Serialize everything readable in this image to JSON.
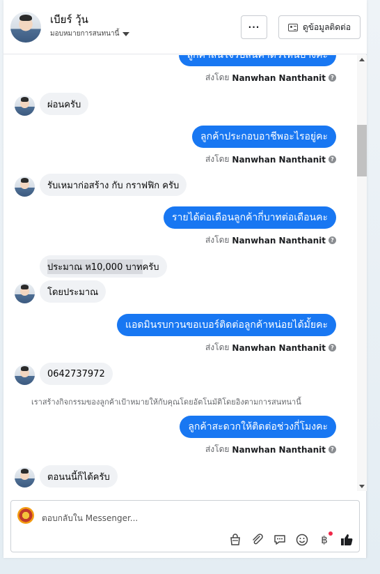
{
  "header": {
    "name": "เบียร์ วุ้น",
    "assignment": "มอบหมายการสนทนานี้",
    "more_label": "···",
    "contact_label": "ดูข้อมูลติดต่อ"
  },
  "thread": {
    "top_partial_text": "ลูกค้าสนใจรับสินค้าตัวไหนบ้างคะ",
    "sent_by_prefix": "ส่งโดย",
    "sender_name": "Nanwhan Nanthanit",
    "messages": {
      "m1": "ผ่อนครับ",
      "m2": "ลูกค้าประกอบอาชีพอะไรอยู่คะ",
      "m3": "รับเหมาก่อสร้าง กับ กราฟฟิก ครับ",
      "m4": "รายได้ต่อเดือนลูกค้ากี่บาทต่อเดือนคะ",
      "m5_highlight": "ประมาณ ห10,000 บาท",
      "m5_rest": " ครับ",
      "m6": "โดยประมาณ",
      "m7": "แอดมินรบกวนขอเบอร์ติดต่อลูกค้าหน่อยได้มั้ยคะ",
      "m8": "0642737972",
      "system": "เราสร้างกิจกรรมของลูกค้าเป้าหมายให้กับคุณโดยอัตโนมัติโดยอิงตามการสนทนานี้",
      "m9": "ลูกค้าสะดวกให้ติดต่อช่วงกี่โมงคะ",
      "m10": "ตอนนนี้ก็ได้ครับ"
    }
  },
  "composer": {
    "placeholder": "ตอบกลับใน Messenger..."
  },
  "icons": {
    "bag": "shopping-bag-icon",
    "attach": "paperclip-icon",
    "saved_reply": "chat-bubble-icon",
    "emoji": "smiley-icon",
    "payment": "baht-icon",
    "like": "thumbs-up-icon"
  },
  "colors": {
    "outgoing_bubble": "#1877f2",
    "incoming_bubble": "#f0f2f5",
    "badge": "#f02849"
  }
}
